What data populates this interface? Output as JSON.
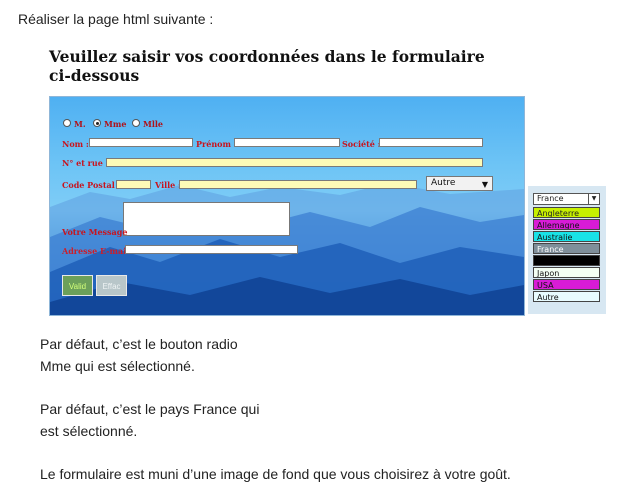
{
  "intro": "Réaliser la page html suivante :",
  "form": {
    "title": "Veuillez saisir vos coordonnées dans le formulaire ci-dessous",
    "radios": [
      {
        "label": "M.",
        "checked": false
      },
      {
        "label": "Mme",
        "checked": true
      },
      {
        "label": "Mlle",
        "checked": false
      }
    ],
    "nom_label": "Nom :",
    "prenom_label": "Prénom :",
    "societe_label": "Société :",
    "rue_label": "N° et rue :",
    "cp_label": "Code Postal :",
    "ville_label": "Ville :",
    "country_value": "Autre",
    "message_label": "Votre Message",
    "email_label": "Adresse E-mail",
    "valid_label": "Valid",
    "effac_label": "Effac"
  },
  "dropdown": {
    "selected": "France",
    "options": [
      {
        "label": "Angleterre",
        "bg": "#c7f000",
        "fg": "#222222"
      },
      {
        "label": "Allemagne",
        "bg": "#d81bd6",
        "fg": "#111111"
      },
      {
        "label": "Australie",
        "bg": "#19e2e6",
        "fg": "#111111"
      },
      {
        "label": "France",
        "bg": "#7f8f9a",
        "fg": "#ffffff"
      },
      {
        "label": "",
        "bg": "#000000",
        "fg": "#ffffff"
      },
      {
        "label": "Japon",
        "bg": "#f3fff3",
        "fg": "#111111"
      },
      {
        "label": "USA",
        "bg": "#d81bd6",
        "fg": "#111111"
      },
      {
        "label": "Autre",
        "bg": "#e8fbff",
        "fg": "#111111"
      }
    ]
  },
  "notes": {
    "radio_line1": "Par défaut, c’est le bouton radio",
    "radio_line2": "Mme qui est sélectionné.",
    "country_line1": "Par défaut, c’est le pays France qui",
    "country_line2": "est sélectionné.",
    "background_line": "Le formulaire est muni d’une image de fond que vous choisirez à votre goût."
  }
}
